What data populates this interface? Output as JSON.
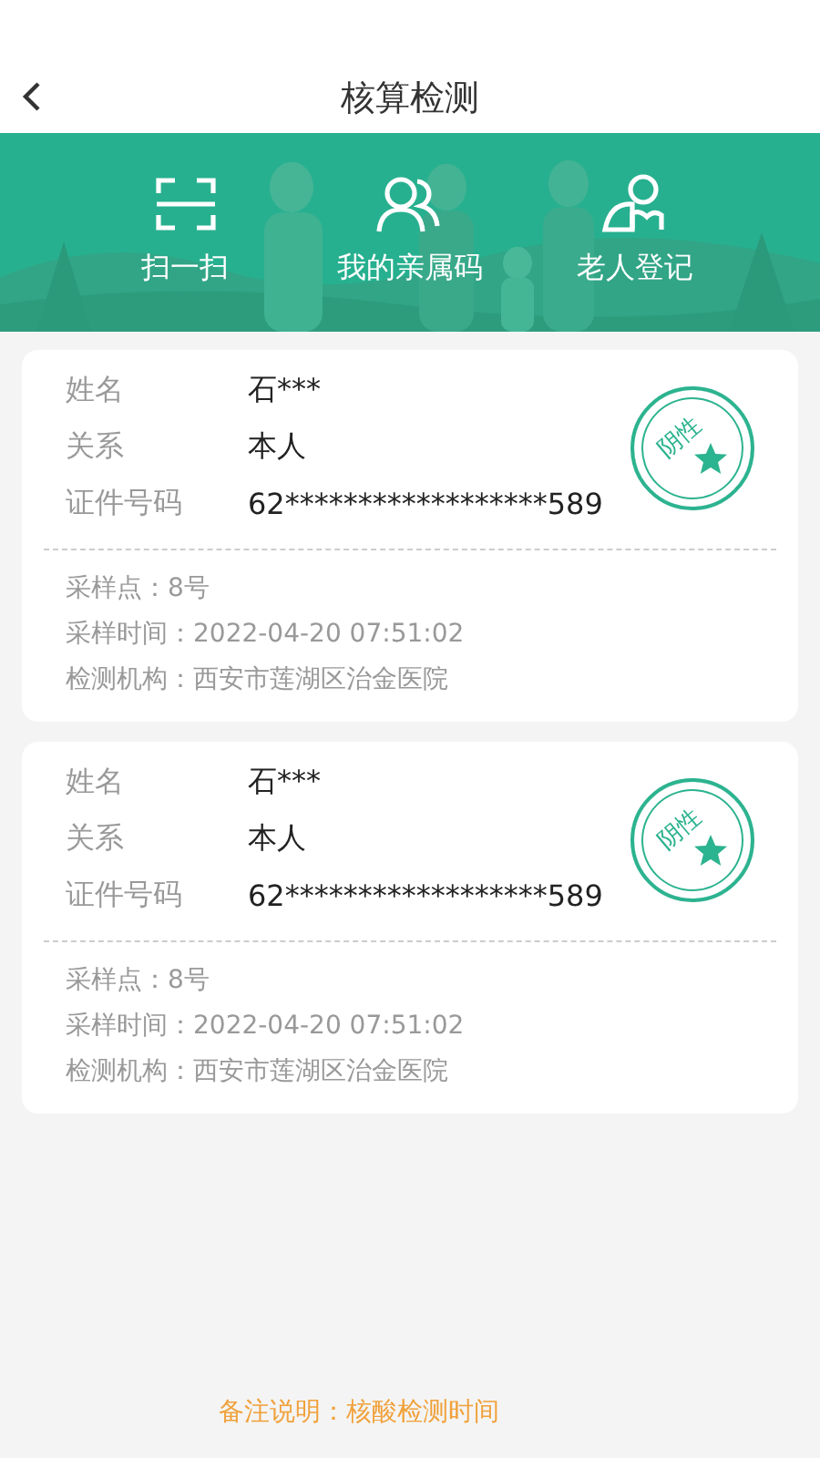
{
  "header": {
    "title": "核算检测"
  },
  "shortcuts": [
    {
      "kind": "scan",
      "label": "扫一扫"
    },
    {
      "kind": "family",
      "label": "我的亲属码"
    },
    {
      "kind": "elder",
      "label": "老人登记"
    }
  ],
  "records": [
    {
      "fields": [
        {
          "label": "姓名",
          "value": "石***"
        },
        {
          "label": "关系",
          "value": "本人"
        },
        {
          "label": "证件号码",
          "value": "62******************589"
        }
      ],
      "result": "阴性",
      "details": [
        "采样点：8号",
        "采样时间：2022-04-20  07:51:02",
        "检测机构：西安市莲湖区治金医院"
      ]
    },
    {
      "fields": [
        {
          "label": "姓名",
          "value": "石***"
        },
        {
          "label": "关系",
          "value": "本人"
        },
        {
          "label": "证件号码",
          "value": "62******************589"
        }
      ],
      "result": "阴性",
      "details": [
        "采样点：8号",
        "采样时间：2022-04-20  07:51:02",
        "检测机构：西安市莲湖区治金医院"
      ]
    }
  ],
  "note": "备注说明：核酸检测时间"
}
